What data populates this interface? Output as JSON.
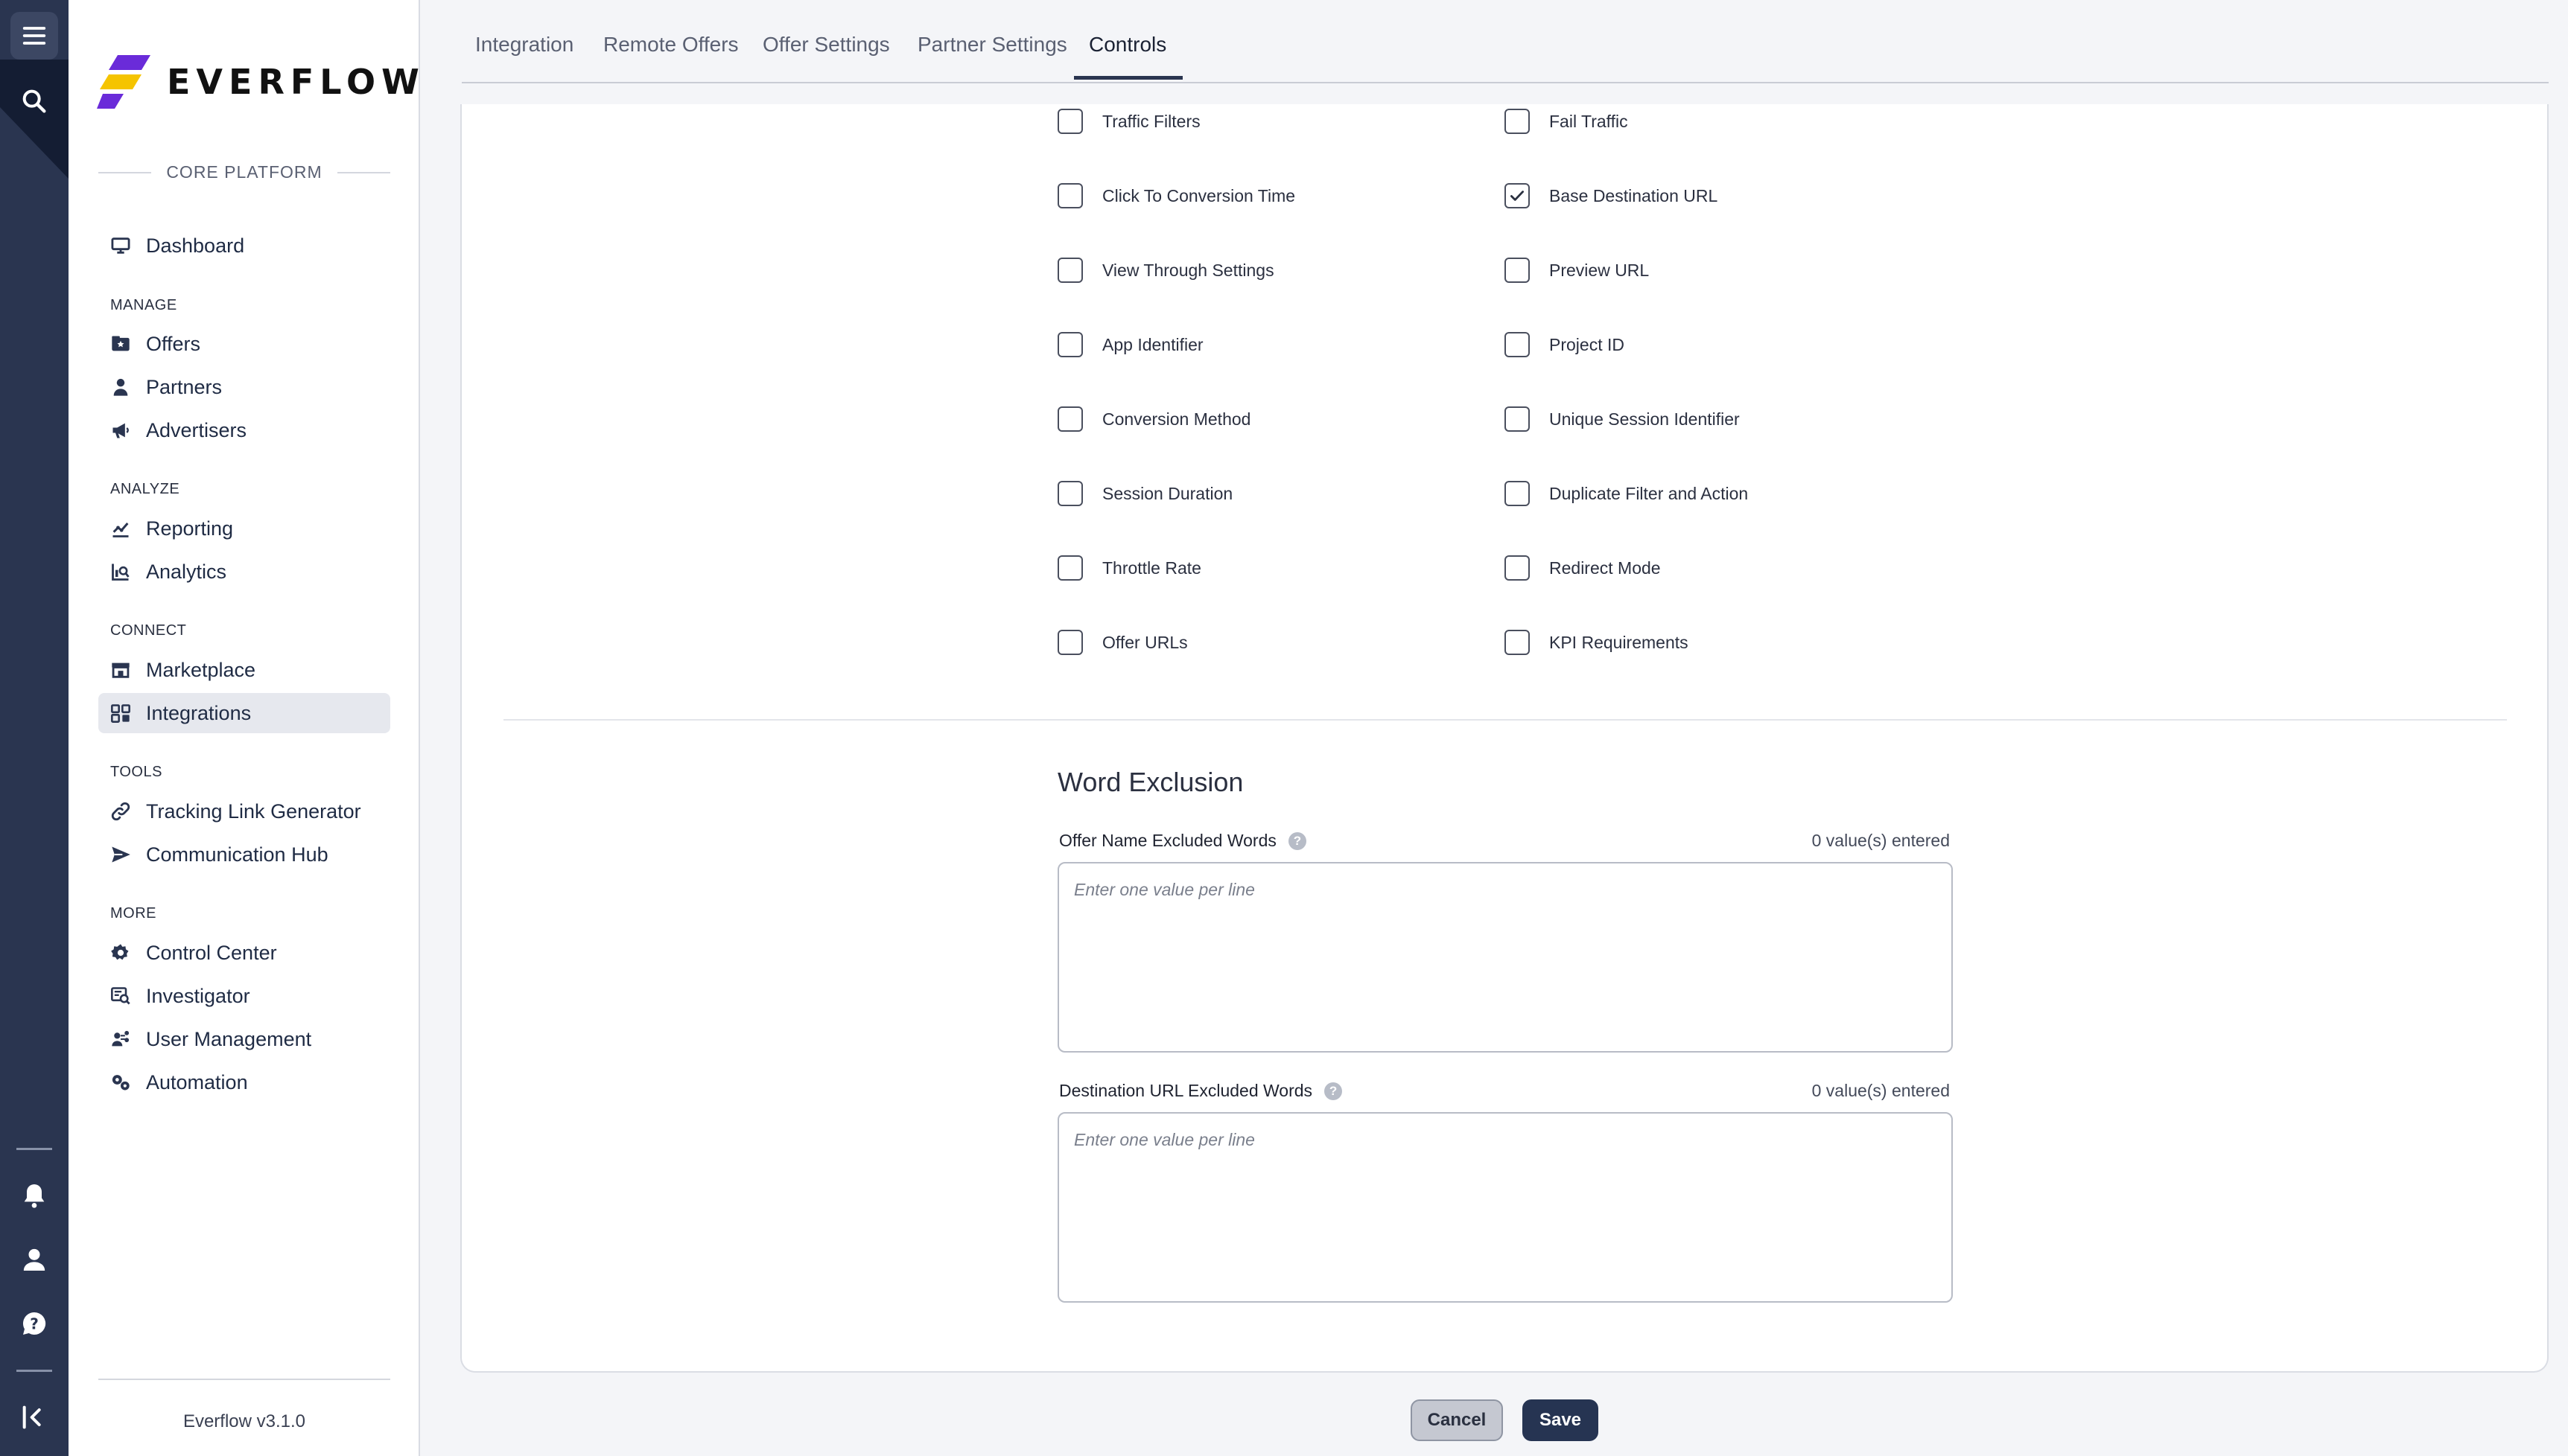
{
  "brand": {
    "name": "EVERFLOW",
    "accent_yellow": "#f5c400",
    "accent_purple": "#6a2bd9"
  },
  "sidebar": {
    "platform_label": "CORE PLATFORM",
    "dashboard": "Dashboard",
    "sections": {
      "manage": "MANAGE",
      "analyze": "ANALYZE",
      "connect": "CONNECT",
      "tools": "TOOLS",
      "more": "MORE"
    },
    "items": {
      "offers": "Offers",
      "partners": "Partners",
      "advertisers": "Advertisers",
      "reporting": "Reporting",
      "analytics": "Analytics",
      "marketplace": "Marketplace",
      "integrations": "Integrations",
      "tracking_link_generator": "Tracking Link Generator",
      "communication_hub": "Communication Hub",
      "control_center": "Control Center",
      "investigator": "Investigator",
      "user_management": "User Management",
      "automation": "Automation"
    },
    "active_item": "Integrations",
    "version": "Everflow v3.1.0"
  },
  "tabs": {
    "integration": "Integration",
    "remote_offers": "Remote Offers",
    "offer_settings": "Offer Settings",
    "partner_settings": "Partner Settings",
    "controls": "Controls",
    "active": "Controls"
  },
  "controls": {
    "left": [
      {
        "label": "Traffic Filters",
        "checked": false
      },
      {
        "label": "Click To Conversion Time",
        "checked": false
      },
      {
        "label": "View Through Settings",
        "checked": false
      },
      {
        "label": "App Identifier",
        "checked": false
      },
      {
        "label": "Conversion Method",
        "checked": false
      },
      {
        "label": "Session Duration",
        "checked": false
      },
      {
        "label": "Throttle Rate",
        "checked": false
      },
      {
        "label": "Offer URLs",
        "checked": false
      }
    ],
    "right": [
      {
        "label": "Fail Traffic",
        "checked": false
      },
      {
        "label": "Base Destination URL",
        "checked": true
      },
      {
        "label": "Preview URL",
        "checked": false
      },
      {
        "label": "Project ID",
        "checked": false
      },
      {
        "label": "Unique Session Identifier",
        "checked": false
      },
      {
        "label": "Duplicate Filter and Action",
        "checked": false
      },
      {
        "label": "Redirect Mode",
        "checked": false
      },
      {
        "label": "KPI Requirements",
        "checked": false
      }
    ]
  },
  "word_exclusion": {
    "title": "Word Exclusion",
    "offer_name": {
      "label": "Offer Name Excluded Words",
      "count": "0 value(s) entered",
      "value": "",
      "placeholder": "Enter one value per line"
    },
    "destination_url": {
      "label": "Destination URL Excluded Words",
      "count": "0 value(s) entered",
      "value": "",
      "placeholder": "Enter one value per line"
    }
  },
  "actions": {
    "cancel": "Cancel",
    "save": "Save"
  }
}
